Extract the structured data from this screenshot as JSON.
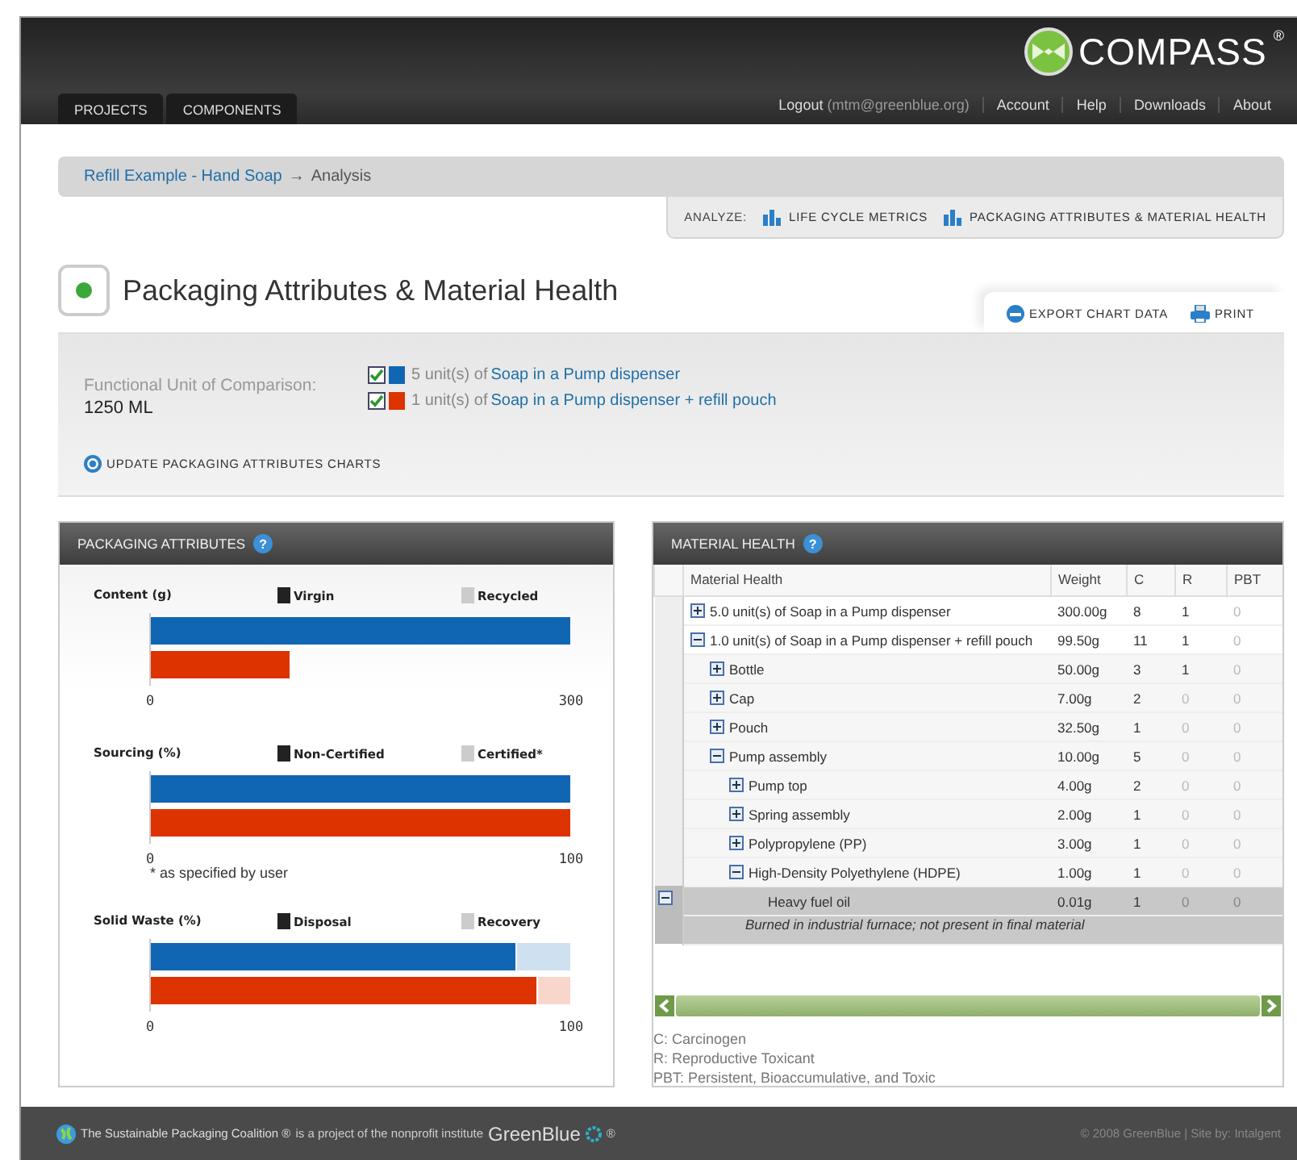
{
  "header": {
    "logo": "COMPASS",
    "logo_mark": "®",
    "tabs": [
      {
        "label": "PROJECTS"
      },
      {
        "label": "COMPONENTS"
      }
    ],
    "links": [
      {
        "label": "Logout",
        "detail": "(mtm@greenblue.org)"
      },
      {
        "label": "Account"
      },
      {
        "label": "Help"
      },
      {
        "label": "Downloads"
      },
      {
        "label": "About"
      }
    ]
  },
  "breadcrumb": {
    "items": [
      "Refill Example - Hand Soap",
      "Analysis"
    ],
    "separator": "→"
  },
  "analyze": {
    "label": "ANALYZE:",
    "links": [
      "LIFE CYCLE METRICS",
      "PACKAGING ATTRIBUTES & MATERIAL HEALTH"
    ]
  },
  "page_title": "Packaging Attributes & Material Health",
  "actions": [
    {
      "kind": "export",
      "label": "EXPORT CHART DATA"
    },
    {
      "kind": "print",
      "label": "PRINT"
    }
  ],
  "comparison": {
    "label": "Functional Unit of Comparison:",
    "value": "1250 ML",
    "items": [
      {
        "checked": true,
        "color": "#1166b3",
        "quantity": "5 unit(s) of",
        "name": "Soap in a Pump dispenser"
      },
      {
        "checked": true,
        "color": "#dd3300",
        "quantity": "1 unit(s) of",
        "name": "Soap in a Pump dispenser + refill pouch"
      }
    ],
    "update": "UPDATE PACKAGING ATTRIBUTES CHARTS"
  },
  "packaging_attributes": {
    "title": "PACKAGING ATTRIBUTES",
    "help": "?",
    "charts": [
      {
        "chart_data": {
          "type": "bar",
          "orientation": "horizontal",
          "stacked": true,
          "title": "Content (g)",
          "xlim": [
            0,
            300
          ],
          "xticks": [
            0,
            300
          ],
          "series": [
            {
              "name": "Virgin",
              "colors": [
                "#1166b3",
                "#dd3300"
              ],
              "values": [
                300,
                100
              ]
            },
            {
              "name": "Recycled",
              "values": [
                0,
                0
              ]
            }
          ]
        }
      },
      {
        "chart_data": {
          "type": "bar",
          "orientation": "horizontal",
          "stacked": true,
          "title": "Sourcing (%)",
          "xlim": [
            0,
            100
          ],
          "xticks": [
            0,
            100
          ],
          "series": [
            {
              "name": "Non-Certified",
              "colors": [
                "#1166b3",
                "#dd3300"
              ],
              "values": [
                100,
                100
              ]
            },
            {
              "name": "Certified*",
              "values": [
                0,
                0
              ]
            }
          ]
        },
        "footnote": "* as specified by user"
      },
      {
        "chart_data": {
          "type": "bar",
          "orientation": "horizontal",
          "stacked": true,
          "title": "Solid Waste (%)",
          "xlim": [
            0,
            100
          ],
          "xticks": [
            0,
            100
          ],
          "series": [
            {
              "name": "Disposal",
              "colors": [
                "#1166b3",
                "#dd3300"
              ],
              "values": [
                87,
                92
              ]
            },
            {
              "name": "Recovery",
              "colors": [
                "#cfe0f0",
                "#f8d6cc"
              ],
              "values": [
                13,
                8
              ]
            }
          ]
        }
      }
    ]
  },
  "material_health": {
    "title": "MATERIAL HEALTH",
    "help": "?",
    "columns": [
      "Material Health",
      "Weight",
      "C",
      "R",
      "PBT"
    ],
    "rows": [
      {
        "name": "5.0 unit(s) of Soap in a Pump dispenser",
        "weight": "300.00g",
        "c": "8",
        "r": "1",
        "pbt": "0",
        "expanded": false,
        "selected": false
      },
      {
        "name": "1.0 unit(s) of Soap in a Pump dispenser + refill pouch",
        "weight": "99.50g",
        "c": "11",
        "r": "1",
        "pbt": "0",
        "expanded": true,
        "selected": false,
        "children": [
          {
            "name": "Bottle",
            "weight": "50.00g",
            "c": "3",
            "r": "1",
            "pbt": "0",
            "expanded": false,
            "selected": false
          },
          {
            "name": "Cap",
            "weight": "7.00g",
            "c": "2",
            "r": "0",
            "pbt": "0",
            "expanded": false,
            "selected": false
          },
          {
            "name": "Pouch",
            "weight": "32.50g",
            "c": "1",
            "r": "0",
            "pbt": "0",
            "expanded": false,
            "selected": false
          },
          {
            "name": "Pump assembly",
            "weight": "10.00g",
            "c": "5",
            "r": "0",
            "pbt": "0",
            "expanded": true,
            "selected": false,
            "children": [
              {
                "name": "Pump top",
                "weight": "4.00g",
                "c": "2",
                "r": "0",
                "pbt": "0",
                "expanded": false,
                "selected": false
              },
              {
                "name": "Spring assembly",
                "weight": "2.00g",
                "c": "1",
                "r": "0",
                "pbt": "0",
                "expanded": false,
                "selected": false
              },
              {
                "name": "Polypropylene (PP)",
                "weight": "3.00g",
                "c": "1",
                "r": "0",
                "pbt": "0",
                "expanded": false,
                "selected": false
              },
              {
                "name": "High-Density Polyethylene (HDPE)",
                "weight": "1.00g",
                "c": "1",
                "r": "0",
                "pbt": "0",
                "expanded": true,
                "selected": false,
                "children": [
                  {
                    "name": "Heavy fuel oil",
                    "weight": "0.01g",
                    "c": "1",
                    "r": "0",
                    "pbt": "0",
                    "expanded": true,
                    "selected": true,
                    "note": "Burned in industrial furnace; not present in final material"
                  }
                ]
              }
            ]
          }
        ]
      }
    ],
    "legend": [
      "C: Carcinogen",
      "R: Reproductive Toxicant",
      "PBT: Persistent, Bioaccumulative, and Toxic"
    ]
  },
  "footer": {
    "coalition": "The Sustainable Packaging Coalition ®",
    "tagline": "is a project of the nonprofit institute",
    "brand": "GreenBlue",
    "brand_mark": "®",
    "copyright": "© 2008 GreenBlue | Site by: Intalgent"
  }
}
